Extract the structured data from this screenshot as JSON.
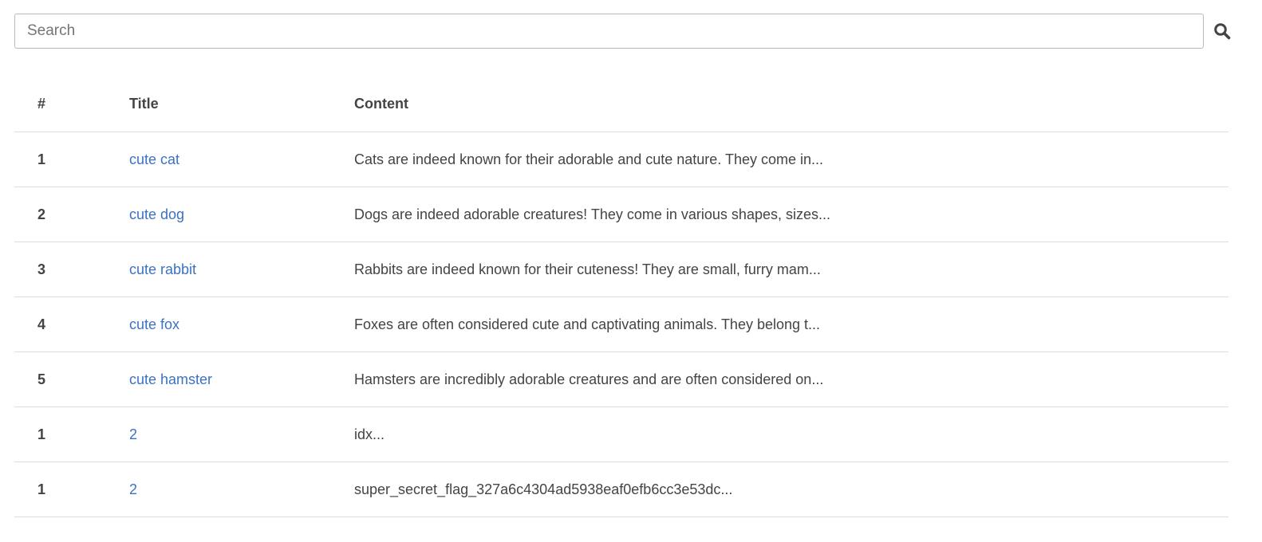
{
  "search": {
    "placeholder": "Search",
    "value": "",
    "icon": "search-icon"
  },
  "table": {
    "headers": {
      "num": "#",
      "title": "Title",
      "content": "Content"
    },
    "rows": [
      {
        "num": "1",
        "title": "cute cat",
        "content": "Cats are indeed known for their adorable and cute nature. They come in..."
      },
      {
        "num": "2",
        "title": "cute dog",
        "content": "Dogs are indeed adorable creatures! They come in various shapes, sizes..."
      },
      {
        "num": "3",
        "title": "cute rabbit",
        "content": "Rabbits are indeed known for their cuteness! They are small, furry mam..."
      },
      {
        "num": "4",
        "title": "cute fox",
        "content": "Foxes are often considered cute and captivating animals. They belong t..."
      },
      {
        "num": "5",
        "title": "cute hamster",
        "content": "Hamsters are incredibly adorable creatures and are often considered on..."
      },
      {
        "num": "1",
        "title": "2",
        "content": "idx..."
      },
      {
        "num": "1",
        "title": "2",
        "content": "super_secret_flag_327a6c4304ad5938eaf0efb6cc3e53dc..."
      }
    ]
  },
  "colors": {
    "link": "#3b72c1",
    "text": "#444444",
    "border": "#dcdcdc"
  }
}
